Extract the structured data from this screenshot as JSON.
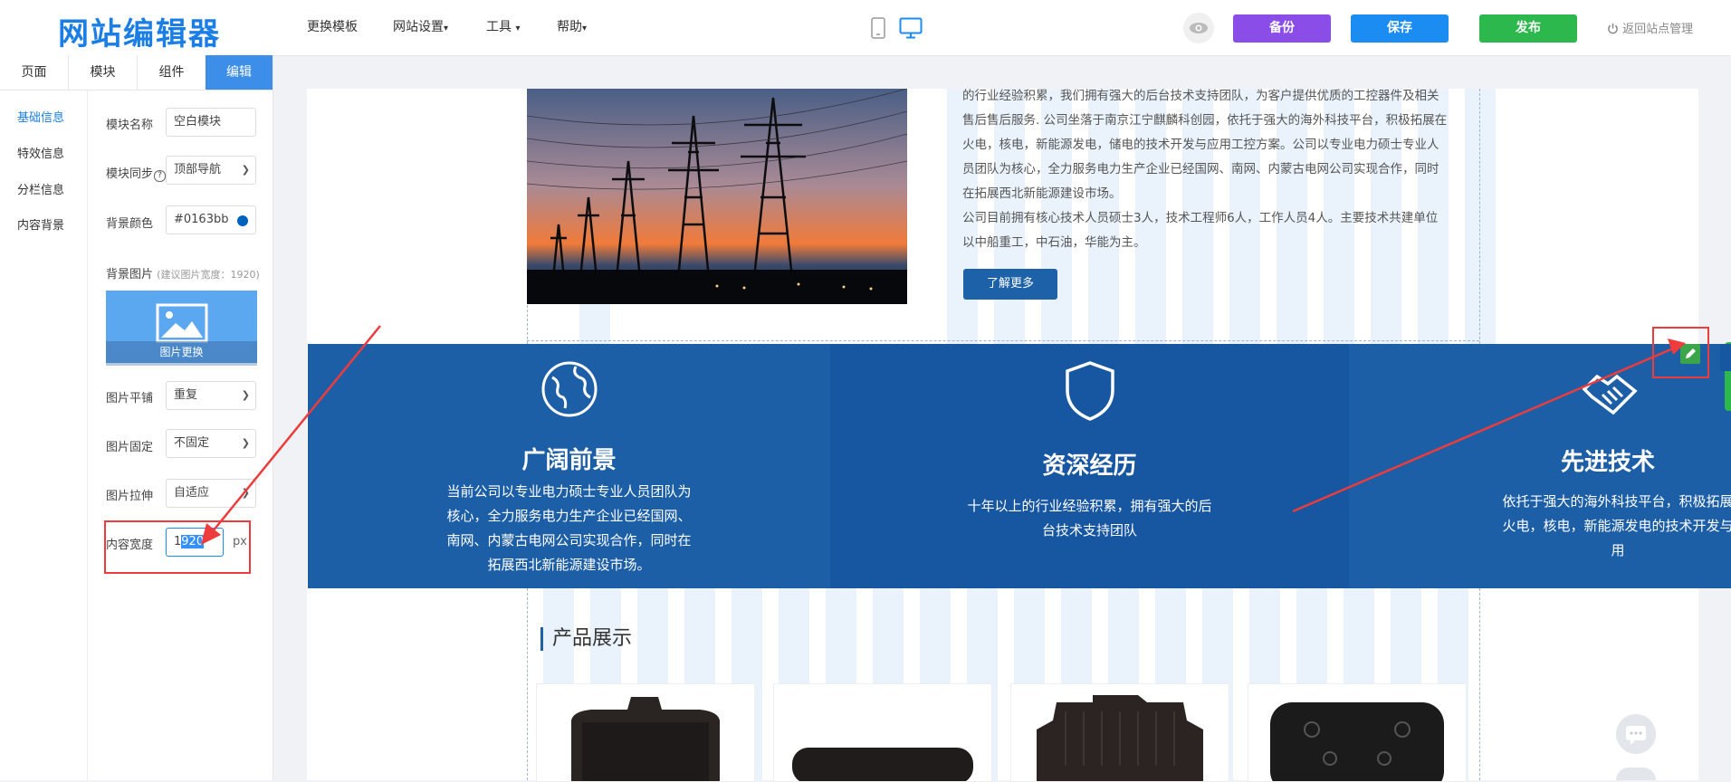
{
  "header": {
    "logo": "网站编辑器",
    "menu": [
      {
        "label": "更换模板"
      },
      {
        "label": "网站设置",
        "caret": "▾"
      },
      {
        "label": "工具",
        "caret": "▾"
      },
      {
        "label": "帮助",
        "caret": "▾"
      }
    ],
    "device_icons": [
      "mobile-icon",
      "desktop-icon"
    ],
    "buttons": {
      "backup": "备份",
      "save": "保存",
      "publish": "发布"
    },
    "back_link": "返回站点管理",
    "colors": {
      "backup": "#8a4de8",
      "save": "#1a8cf2",
      "publish": "#2db84d"
    }
  },
  "left_panel": {
    "tabs": [
      {
        "label": "页面"
      },
      {
        "label": "模块"
      },
      {
        "label": "组件"
      },
      {
        "label": "编辑"
      }
    ],
    "active_tab": "编辑",
    "side_nav": [
      {
        "label": "基础信息"
      },
      {
        "label": "特效信息"
      },
      {
        "label": "分栏信息"
      },
      {
        "label": "内容背景"
      }
    ],
    "fields": {
      "module_name": {
        "label": "模块名称",
        "value": "空白模块"
      },
      "module_sync": {
        "label": "模块同步",
        "help_icon": "?",
        "value": "顶部导航"
      },
      "bg_color": {
        "label": "背景颜色",
        "value": "#0163bb"
      },
      "bg_image": {
        "label": "背景图片",
        "hint": "(建议图片宽度：1920)",
        "button": "图片更换"
      },
      "image_tile": {
        "label": "图片平铺",
        "value": "重复"
      },
      "image_fixed": {
        "label": "图片固定",
        "value": "不固定"
      },
      "image_stretch": {
        "label": "图片拉伸",
        "value": "自适应"
      },
      "content_width": {
        "label": "内容宽度",
        "value_prefix": "1",
        "value_selected": "920",
        "unit": "px"
      }
    }
  },
  "canvas": {
    "intro_lines": [
      "的行业经验积累，我们拥有强大的后台技术支持团队，为客户提供优质的工控器件及相关",
      "售后售后服务. 公司坐落于南京江宁麒麟科创园，依托于强大的海外科技平台，积极拓展在",
      "火电，核电，新能源发电，储电的技术开发与应用工控方案。公司以专业电力硕士专业人",
      "员团队为核心，全力服务电力生产企业已经国网、南网、内蒙古电网公司实现合作，同时",
      "在拓展西北新能源建设市场。",
      "公司目前拥有核心技术人员硕士3人，技术工程师6人，工作人员4人。主要技术共建单位",
      "以中船重工，中石油，华能为主。"
    ],
    "learn_more": "了解更多",
    "features": [
      {
        "icon": "globe-icon",
        "title": "广阔前景",
        "lines": [
          "当前公司以专业电力硕士专业人员团队为",
          "核心，全力服务电力生产企业已经国网、",
          "南网、内蒙古电网公司实现合作，同时在",
          "拓展西北新能源建设市场。"
        ]
      },
      {
        "icon": "shield-icon",
        "title": "资深经历",
        "lines": [
          "十年以上的行业经验积累，拥有强大的后",
          "台技术支持团队"
        ]
      },
      {
        "icon": "handshake-icon",
        "title": "先进技术",
        "lines": [
          "依托于强大的海外科技平台，积极拓展",
          "火电，核电，新能源发电的技术开发与",
          "用"
        ]
      }
    ],
    "feature_colors": [
      "#1d5fa6",
      "#1756a0",
      "#1d5fa6"
    ],
    "products_title": "产品展示"
  }
}
